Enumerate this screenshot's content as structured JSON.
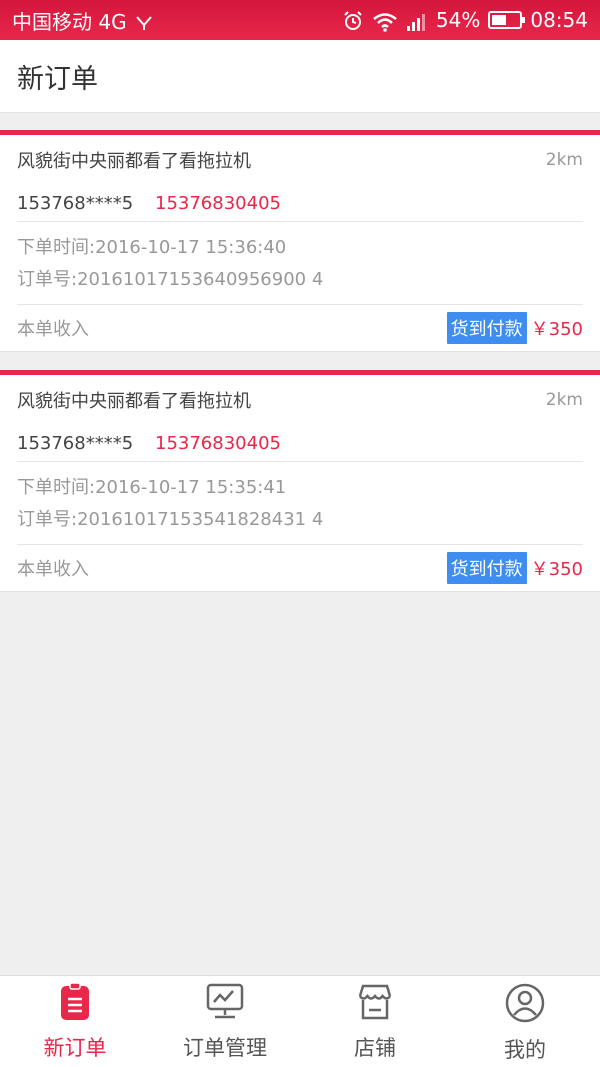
{
  "status_bar": {
    "carrier": "中国移动 4G",
    "battery": "54%",
    "battery_level": 0.54,
    "time": "08:54"
  },
  "header": {
    "title": "新订单"
  },
  "orders": [
    {
      "address": "风貌街中央丽都看了看拖拉机",
      "distance": "2km",
      "phone_masked": "153768****5",
      "phone_full": "15376830405",
      "order_time": "下单时间:2016-10-17 15:36:40",
      "order_no": "订单号:20161017153640956900 4",
      "income_label": "本单收入",
      "pay_method": "货到付款",
      "price": "￥350"
    },
    {
      "address": "风貌街中央丽都看了看拖拉机",
      "distance": "2km",
      "phone_masked": "153768****5",
      "phone_full": "15376830405",
      "order_time": "下单时间:2016-10-17 15:35:41",
      "order_no": "订单号:20161017153541828431 4",
      "income_label": "本单收入",
      "pay_method": "货到付款",
      "price": "￥350"
    }
  ],
  "tabs": [
    {
      "label": "新订单",
      "icon": "new-order-icon",
      "active": true
    },
    {
      "label": "订单管理",
      "icon": "order-manage-icon",
      "active": false
    },
    {
      "label": "店铺",
      "icon": "store-icon",
      "active": false
    },
    {
      "label": "我的",
      "icon": "profile-icon",
      "active": false
    }
  ],
  "colors": {
    "accent": "#e8274a",
    "badge": "#3d8ef0"
  }
}
